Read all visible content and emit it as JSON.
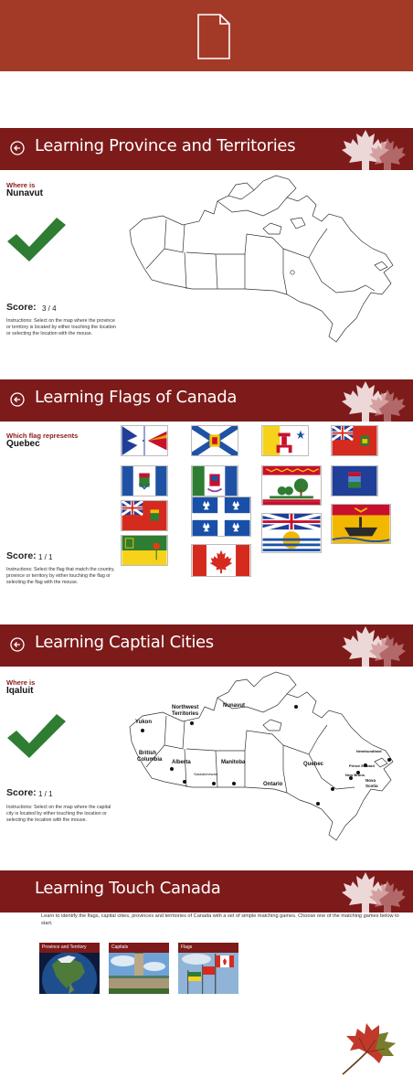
{
  "app_icon": "document-icon",
  "colors": {
    "top_bar": "#a33a28",
    "header": "#7d1a1a",
    "accent_text": "#8a1a1a",
    "check": "#2e7d32"
  },
  "province_screen": {
    "title": "Learning Province and Territories",
    "prompt": "Where is",
    "answer": "Nunavut",
    "score_label": "Score:",
    "score_value": "3 / 4",
    "instructions": "Instructions: Select on the map where the province or territory is located by either touching the location or selecting the location with the mouse."
  },
  "flags_screen": {
    "title": "Learning Flags of Canada",
    "prompt": "Which flag represents",
    "answer": "Quebec",
    "score_label": "Score:",
    "score_value": "1 / 1",
    "instructions": "Instructions: Select the flag that match the country, province or territory by either touching the flag or selecting the flag with the mouse.",
    "flags": [
      "Newfoundland and Labrador",
      "Nova Scotia",
      "Nunavut",
      "Ontario",
      "Northwest Territories",
      "Yukon",
      "Prince Edward Island",
      "Alberta",
      "Manitoba",
      "Quebec",
      "British Columbia",
      "New Brunswick",
      "Saskatchewan",
      "Canada"
    ]
  },
  "capitals_screen": {
    "title": "Learning Captial Cities",
    "prompt": "Where is",
    "answer": "Iqaluit",
    "score_label": "Score:",
    "score_value": "1 / 1",
    "instructions": "Instructions: Select on the map where the capital city is located by either touching the location or selecting the location with the mouse.",
    "map_labels": {
      "yukon": "Yukon",
      "nwt_1": "Northwest",
      "nwt_2": "Territories",
      "nunavut": "Nunavut",
      "newfoundland": "Newfoundland",
      "bc_1": "British",
      "bc_2": "Columbia",
      "alberta": "Alberta",
      "manitoba": "Manitoba",
      "saskatchewan": "Saskatchewan",
      "quebec": "Quebec",
      "ontario": "Ontario",
      "pei": "Prince Edward",
      "nb": "New Bruns.",
      "ns_1": "Nova",
      "ns_2": "Scotia"
    }
  },
  "home_screen": {
    "title": "Learning Touch Canada",
    "description": "Learn to identify the flags, capital cities, provinces and territories of Canada with a set of simple matching games. Choose one of the matching games below to start.",
    "tiles": [
      {
        "label": "Province and Territory"
      },
      {
        "label": "Capitals"
      },
      {
        "label": "Flags"
      }
    ]
  }
}
